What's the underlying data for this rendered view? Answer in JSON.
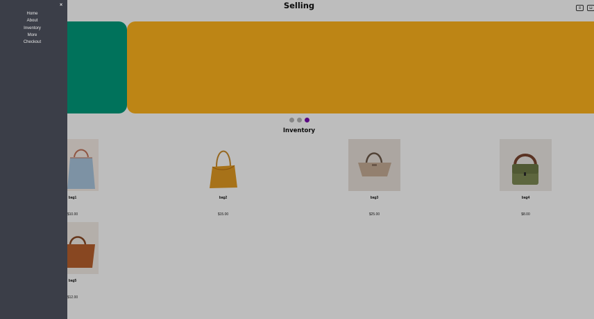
{
  "header": {
    "title": "Selling",
    "buttons": [
      {
        "label": "☰",
        "icon": "menu-icon"
      },
      {
        "label": "🛒",
        "icon": "cart-icon"
      }
    ]
  },
  "carousel": {
    "slide_colors": [
      "#009a7b",
      "#ffb41d"
    ],
    "dot_colors": [
      "#b5b5b5",
      "#b5b5b5",
      "#7b0bb0"
    ],
    "active_index": 2
  },
  "inventory": {
    "title": "Inventory",
    "products": [
      {
        "name": "bag1",
        "price": "$10.00"
      },
      {
        "name": "bag2",
        "price": "$15.00"
      },
      {
        "name": "bag3",
        "price": "$25.00"
      },
      {
        "name": "bag4",
        "price": "$8.00"
      },
      {
        "name": "bag5",
        "price": "$12.00"
      }
    ]
  },
  "sidenav": {
    "close_label": "×",
    "items": [
      {
        "label": "Home"
      },
      {
        "label": "About"
      },
      {
        "label": "Inventory"
      },
      {
        "label": "More"
      },
      {
        "label": "Checkout"
      }
    ]
  },
  "colors": {
    "sidenav_bg": "#3b3e48",
    "overlay": "rgba(0,0,0,0.26)"
  }
}
